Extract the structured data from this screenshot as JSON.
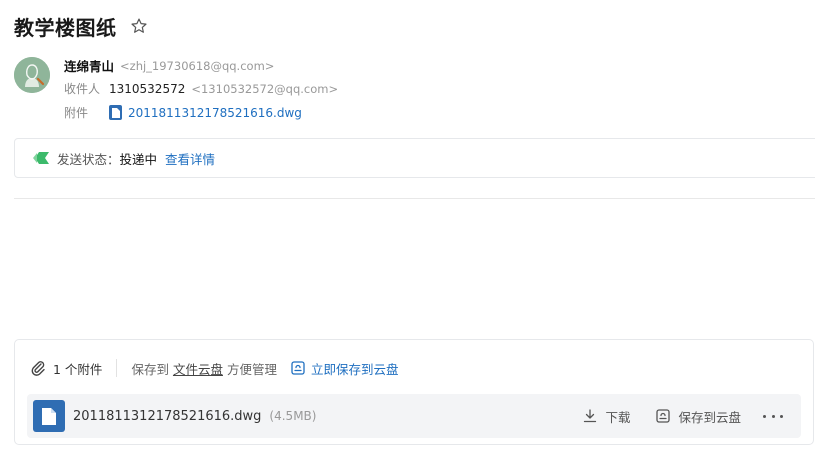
{
  "mail": {
    "subject": "教学楼图纸",
    "sender": {
      "name": "连绵青山",
      "address": "<zhj_19730618@qq.com>"
    },
    "recipient": {
      "label": "收件人",
      "name": "1310532572",
      "address": "<1310532572@qq.com>"
    },
    "attachment_row": {
      "label": "附件",
      "file": "201181131217852161​6.dwg"
    }
  },
  "status": {
    "label": "发送状态：",
    "value": "投递中",
    "link": "查看详情",
    "icon": "send-status-icon",
    "color": "#3cba6b"
  },
  "attachments": {
    "count_text": "1 个附件",
    "save_prefix": "保存到",
    "cloud_link": "文件云盘",
    "save_suffix": "方便管理",
    "save_now": "立即保存到云盘",
    "files": [
      {
        "name": "201181131217852161​6.dwg",
        "size": "(4.5MB)",
        "download": "下载",
        "save_cloud": "保存到云盘"
      }
    ]
  },
  "colors": {
    "accent": "#1f6fc0",
    "file_icon": "#2f6db3",
    "avatar": "#8fb59a"
  }
}
